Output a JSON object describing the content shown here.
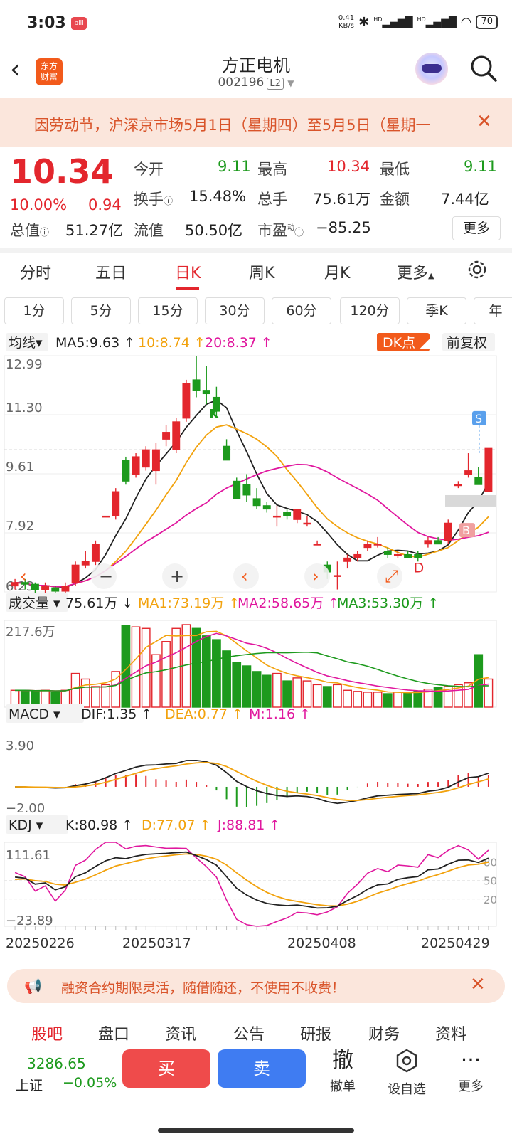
{
  "status_bar": {
    "time": "3:03",
    "net_speed_top": "0.41",
    "net_speed_unit": "KB/s",
    "battery": "70",
    "hd1": "HD",
    "hd2": "HD"
  },
  "header": {
    "logo_line1": "东方",
    "logo_line2": "财富",
    "title": "方正电机",
    "code": "002196",
    "level": "L2"
  },
  "banner": {
    "text": "因劳动节，沪深京市场5月1日（星期四）至5月5日（星期一"
  },
  "quote": {
    "price": "10.34",
    "change_pct": "10.00%",
    "change": "0.94",
    "open_label": "今开",
    "open": "9.11",
    "high_label": "最高",
    "high": "10.34",
    "low_label": "最低",
    "low": "9.11",
    "turnover_label": "换手",
    "turnover": "15.48%",
    "volume_label": "总手",
    "volume": "75.61万",
    "amount_label": "金额",
    "amount": "7.44亿",
    "mcap_label": "总值",
    "mcap": "51.27亿",
    "float_label": "流值",
    "float": "50.50亿",
    "pe_label": "市盈",
    "pe_sup": "动",
    "pe": "−85.25",
    "more": "更多"
  },
  "tabs": [
    "分时",
    "五日",
    "日K",
    "周K",
    "月K",
    "更多"
  ],
  "periods": [
    "1分",
    "5分",
    "15分",
    "30分",
    "60分",
    "120分",
    "季K",
    "年"
  ],
  "chart_data": [
    {
      "type": "candlestick",
      "panel": "price",
      "indicator_selector": "均线",
      "legend": [
        {
          "name": "MA5",
          "value": "9.63",
          "color": "#222222"
        },
        {
          "name": "10",
          "value": "8.74",
          "color": "#f2a20d"
        },
        {
          "name": "20",
          "value": "8.37",
          "color": "#e0179e"
        }
      ],
      "badge": "DK点",
      "adjust": "前复权",
      "y_ticks": [
        "12.99",
        "11.30",
        "9.61",
        "7.92",
        "6.23"
      ],
      "ylim": [
        6.23,
        12.99
      ],
      "markers": [
        "K",
        "D",
        "S",
        "B"
      ],
      "ohlc": [
        [
          6.4,
          6.6,
          6.3,
          6.5
        ],
        [
          6.5,
          6.6,
          6.3,
          6.45
        ],
        [
          6.45,
          6.5,
          6.2,
          6.3
        ],
        [
          6.3,
          6.5,
          6.2,
          6.4
        ],
        [
          6.35,
          6.4,
          6.2,
          6.25
        ],
        [
          6.25,
          6.5,
          6.2,
          6.4
        ],
        [
          6.5,
          7.1,
          6.4,
          7.0
        ],
        [
          7.0,
          7.4,
          6.9,
          7.1
        ],
        [
          7.1,
          7.7,
          7.0,
          7.6
        ],
        [
          8.4,
          8.4,
          8.4,
          8.4
        ],
        [
          8.4,
          9.2,
          8.3,
          9.1
        ],
        [
          10.0,
          10.1,
          9.3,
          9.4
        ],
        [
          9.6,
          10.2,
          9.5,
          10.1
        ],
        [
          9.8,
          10.4,
          9.7,
          10.3
        ],
        [
          9.7,
          10.5,
          9.3,
          10.3
        ],
        [
          10.6,
          11.0,
          10.4,
          10.8
        ],
        [
          10.3,
          11.2,
          10.2,
          11.1
        ],
        [
          11.2,
          12.3,
          11.1,
          12.2
        ],
        [
          12.3,
          12.99,
          11.8,
          12.0
        ],
        [
          12.0,
          12.7,
          11.6,
          11.9
        ],
        [
          11.8,
          12.1,
          11.2,
          11.4
        ],
        [
          10.4,
          10.6,
          10.1,
          10.0
        ],
        [
          9.4,
          9.5,
          8.9,
          8.9
        ],
        [
          9.3,
          9.6,
          8.8,
          9.0
        ],
        [
          8.9,
          9.2,
          8.6,
          8.7
        ],
        [
          8.7,
          8.8,
          8.5,
          8.6
        ],
        [
          8.4,
          8.7,
          8.1,
          8.4
        ],
        [
          8.5,
          8.6,
          8.3,
          8.4
        ],
        [
          8.3,
          8.6,
          8.2,
          8.6
        ],
        [
          8.2,
          8.4,
          8.1,
          8.2
        ],
        [
          7.6,
          7.7,
          7.6,
          7.6
        ],
        [
          7.0,
          7.1,
          6.6,
          6.8
        ],
        [
          6.7,
          7.1,
          6.3,
          6.7
        ],
        [
          7.1,
          7.3,
          6.9,
          7.2
        ],
        [
          7.2,
          7.4,
          7.1,
          7.3
        ],
        [
          7.5,
          7.7,
          7.4,
          7.6
        ],
        [
          7.6,
          7.8,
          7.5,
          7.6
        ],
        [
          7.4,
          7.5,
          7.2,
          7.3
        ],
        [
          7.3,
          7.4,
          7.2,
          7.3
        ],
        [
          7.3,
          7.4,
          7.2,
          7.2
        ],
        [
          7.3,
          7.4,
          7.1,
          7.2
        ],
        [
          7.6,
          7.8,
          7.5,
          7.7
        ],
        [
          7.7,
          7.8,
          7.6,
          7.6
        ],
        [
          7.7,
          8.3,
          7.6,
          8.2
        ],
        [
          9.3,
          9.4,
          9.2,
          9.3
        ],
        [
          9.6,
          10.2,
          9.5,
          9.7
        ],
        [
          9.5,
          9.8,
          9.3,
          9.3
        ],
        [
          9.11,
          10.34,
          9.11,
          10.34
        ]
      ]
    },
    {
      "type": "bar",
      "panel": "volume",
      "indicator_selector": "成交量",
      "current": "75.61万",
      "legend": [
        {
          "name": "MA1",
          "value": "73.19万",
          "color": "#f2a20d"
        },
        {
          "name": "MA2",
          "value": "58.65万",
          "color": "#e0179e"
        },
        {
          "name": "MA3",
          "value": "53.30万",
          "color": "#1d9a1d"
        }
      ],
      "y_ticks": [
        "217.6万"
      ],
      "values": [
        45,
        45,
        42,
        45,
        40,
        45,
        90,
        75,
        55,
        60,
        95,
        218,
        214,
        210,
        140,
        175,
        210,
        220,
        210,
        190,
        180,
        150,
        120,
        110,
        95,
        85,
        90,
        70,
        78,
        70,
        60,
        55,
        60,
        45,
        42,
        40,
        40,
        36,
        40,
        38,
        42,
        48,
        52,
        55,
        60,
        65,
        140,
        75
      ]
    },
    {
      "type": "macd",
      "panel": "macd",
      "indicator_selector": "MACD",
      "legend": [
        {
          "name": "DIF",
          "value": "1.35",
          "color": "#222222"
        },
        {
          "name": "DEA",
          "value": "0.77",
          "color": "#f2a20d"
        },
        {
          "name": "M",
          "value": "1.16",
          "color": "#e0179e"
        }
      ],
      "y_ticks": [
        "3.90",
        "−2.00"
      ],
      "ylim": [
        -2.0,
        3.9
      ]
    },
    {
      "type": "line",
      "panel": "kdj",
      "indicator_selector": "KDJ",
      "legend": [
        {
          "name": "K",
          "value": "80.98",
          "color": "#222222"
        },
        {
          "name": "D",
          "value": "77.07",
          "color": "#f2a20d"
        },
        {
          "name": "J",
          "value": "88.81",
          "color": "#e0179e"
        }
      ],
      "y_ticks": [
        "111.61",
        "−23.89"
      ],
      "right_ticks": [
        "80",
        "50",
        "20"
      ],
      "ylim": [
        -23.89,
        111.61
      ],
      "x_ticks": [
        "20250226",
        "20250317",
        "20250408",
        "20250429"
      ]
    }
  ],
  "hint": {
    "text": "融资合约期限灵活，随借随还，不使用不收费！"
  },
  "sub_tabs": [
    "股吧",
    "盘口",
    "资讯",
    "公告",
    "研报",
    "财务",
    "资料"
  ],
  "bottom": {
    "index_value": "3286.65",
    "index_name": "上证",
    "index_pct": "−0.05%",
    "buy": "买",
    "sell": "卖",
    "cancel_glyph": "撤",
    "cancel": "撤单",
    "watch": "设自选",
    "more": "更多"
  }
}
